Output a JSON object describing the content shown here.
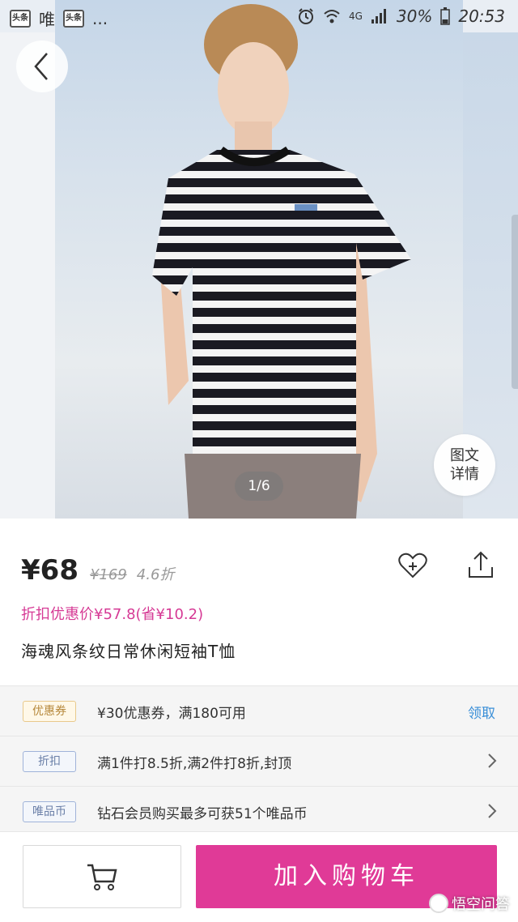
{
  "status_bar": {
    "app_badge_1": "头条",
    "app_name": "唯",
    "app_badge_2": "头条",
    "more": "...",
    "network": "4G",
    "battery": "30%",
    "time": "20:53"
  },
  "gallery": {
    "page_indicator": "1/6",
    "detail_line1": "图文",
    "detail_line2": "详情"
  },
  "price": {
    "current": "¥68",
    "original": "¥169",
    "discount": "4.6折"
  },
  "promo_price": "折扣优惠价¥57.8(省¥10.2)",
  "product_title": "海魂风条纹日常休闲短袖T恤",
  "info_rows": [
    {
      "tag": "优惠券",
      "text": "¥30优惠券，满180可用",
      "action": "领取"
    },
    {
      "tag": "折扣",
      "text": "满1件打8.5折,满2件打8折,封顶"
    },
    {
      "tag": "唯品币",
      "text": "钻石会员购买最多可获51个唯品币"
    }
  ],
  "bottom_bar": {
    "add_to_cart": "加入购物车"
  },
  "watermark": "悟空问答",
  "colors": {
    "accent": "#e03a97",
    "promo_text": "#d63a95",
    "link_blue": "#3a8fd8"
  }
}
